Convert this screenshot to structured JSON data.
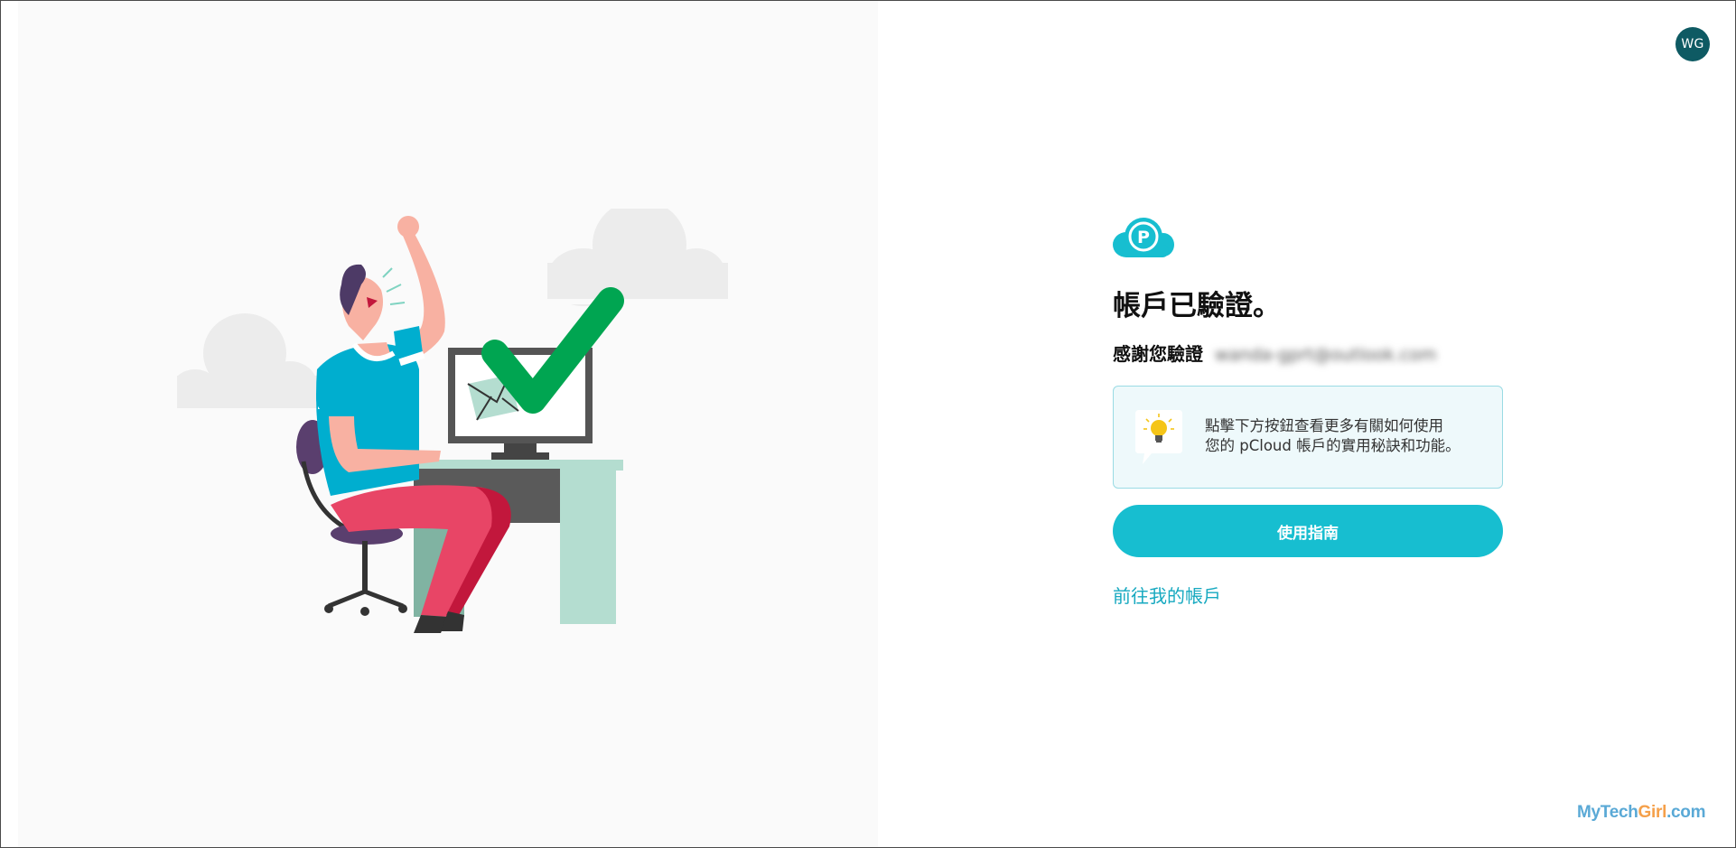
{
  "header": {
    "avatar_initials": "WG"
  },
  "main": {
    "title": "帳戶已驗證。",
    "subtitle_prefix": "感謝您驗證",
    "email": "wanda-gprt@outlook.com",
    "tip_line1": "點擊下方按鈕查看更多有關如何使用",
    "tip_line2": "您的 pCloud 帳戶的實用秘訣和功能。",
    "guide_button_label": "使用指南",
    "account_link_label": "前往我的帳戶"
  },
  "watermark": {
    "part1": "MyTech",
    "part2": "Girl",
    "part3": ".com"
  },
  "colors": {
    "accent": "#17bed0",
    "link": "#17a9c0",
    "avatar_bg": "#0e5a63",
    "tip_bg": "#eef9fb",
    "tip_border": "#9adbe4"
  },
  "icons": [
    "pcloud-logo-icon",
    "lightbulb-icon",
    "verified-illustration"
  ]
}
